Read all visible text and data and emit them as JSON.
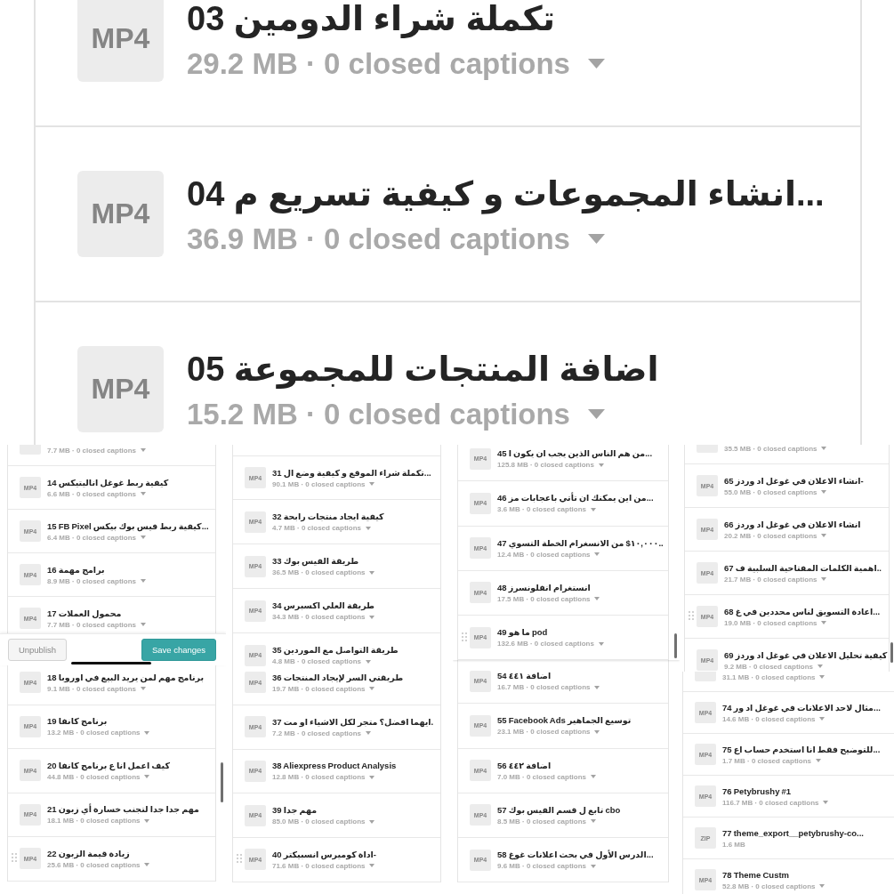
{
  "zoomed_list": {
    "files": [
      {
        "type": "MP4",
        "title": "03 تكملة شراء الدومين",
        "meta": "29.2 MB · 0 closed captions",
        "captions_menu": true,
        "hovered": false
      },
      {
        "type": "MP4",
        "title": "04 انشاء المجموعات و كيفية تسريع م...",
        "meta": "36.9 MB · 0 closed captions",
        "captions_menu": true,
        "hovered": false
      },
      {
        "type": "MP4",
        "title": "05 اضافة المنتجات للمجموعة",
        "meta": "15.2 MB · 0 closed captions",
        "captions_menu": true,
        "hovered": false
      }
    ]
  },
  "columns": [
    {
      "sections": [
        {
          "kind": "list",
          "scroll_indicator": false,
          "files": [
            {
              "meta": "7.7 MB · 0 closed captions",
              "captions_menu": true,
              "hovered": false
            },
            {
              "type": "MP4",
              "title": "14 كيفية ربط غوغل اناليتيكس",
              "meta": "6.6 MB · 0 closed captions",
              "captions_menu": true,
              "hovered": false
            },
            {
              "type": "MP4",
              "title": "15 FB Pixel كيفية ربط فيس بوك بيكس...",
              "meta": "6.4 MB · 0 closed captions",
              "captions_menu": true,
              "hovered": false
            },
            {
              "type": "MP4",
              "title": "16 برامج مهمة",
              "meta": "8.9 MB · 0 closed captions",
              "captions_menu": true,
              "hovered": false
            },
            {
              "type": "MP4",
              "title": "17 محمول العملات",
              "meta": "7.7 MB · 0 closed captions",
              "captions_menu": true,
              "hovered": false
            }
          ]
        },
        {
          "kind": "toolbar",
          "home_indicator": true,
          "buttons": [
            {
              "label": "Unpublish",
              "kind": "secondary"
            },
            {
              "label": "Save changes",
              "kind": "primary"
            }
          ]
        },
        {
          "kind": "list",
          "scroll_indicator": true,
          "files": [
            {
              "type": "MP4",
              "title": "18 برنامج مهم لمن يريد البيع في اوروبا",
              "meta": "9.1 MB · 0 closed captions",
              "captions_menu": true,
              "hovered": false
            },
            {
              "type": "MP4",
              "title": "19 برنامج كانفا",
              "meta": "13.2 MB · 0 closed captions",
              "captions_menu": true,
              "hovered": false
            },
            {
              "type": "MP4",
              "title": "20 كيف اعمل انا ع برنامج كانفا",
              "meta": "44.8 MB · 0 closed captions",
              "captions_menu": true,
              "hovered": false
            },
            {
              "type": "MP4",
              "title": "21 مهم جدا جدا لتجنب خسارة أي زبون",
              "meta": "18.1 MB · 0 closed captions",
              "captions_menu": true,
              "hovered": false
            },
            {
              "type": "MP4",
              "title": "22 زيادة قيمة الزبون",
              "meta": "25.6 MB · 0 closed captions",
              "captions_menu": true,
              "hovered": true
            }
          ]
        }
      ]
    },
    {
      "sections": [
        {
          "kind": "list",
          "scroll_indicator": false,
          "files": [
            {
              "type": "MP4",
              "title": "31 تكملة شراء الموقع و كيفية وضع ال...",
              "meta": "90.1 MB · 0 closed captions",
              "captions_menu": true,
              "hovered": false
            },
            {
              "type": "MP4",
              "title": "32 كيفية ايجاد منتجات رابحة",
              "meta": "4.7 MB · 0 closed captions",
              "captions_menu": true,
              "hovered": false
            },
            {
              "type": "MP4",
              "title": "33 طريقة الفيس بوك",
              "meta": "36.5 MB · 0 closed captions",
              "captions_menu": true,
              "hovered": false
            },
            {
              "type": "MP4",
              "title": "34 طريقة العلي اكسبرس",
              "meta": "34.3 MB · 0 closed captions",
              "captions_menu": true,
              "hovered": false
            },
            {
              "type": "MP4",
              "title": "35 طريقة التواصل مع الموردين",
              "meta": "4.8 MB · 0 closed captions",
              "captions_menu": true,
              "hovered": false
            }
          ]
        },
        {
          "kind": "list",
          "scroll_indicator": false,
          "files": [
            {
              "type": "MP4",
              "title": "36 طريقتي السر لإيجاد المنتجات",
              "meta": "19.7 MB · 0 closed captions",
              "captions_menu": true,
              "hovered": false
            },
            {
              "type": "MP4",
              "title": "37 ايهما افضل؟ متجر لكل الاشياء او مت.",
              "meta": "7.2 MB · 0 closed captions",
              "captions_menu": true,
              "hovered": false
            },
            {
              "type": "MP4",
              "title": "38 Aliexpress Product Analysis",
              "meta": "12.8 MB · 0 closed captions",
              "captions_menu": true,
              "hovered": false
            },
            {
              "type": "MP4",
              "title": "39 مهم جدا",
              "meta": "85.0 MB · 0 closed captions",
              "captions_menu": true,
              "hovered": false
            },
            {
              "type": "MP4",
              "title": "40 اداة كوميرس انسبيكتر-",
              "meta": "71.6 MB · 0 closed captions",
              "captions_menu": true,
              "hovered": true
            }
          ]
        }
      ]
    },
    {
      "sections": [
        {
          "kind": "list",
          "scroll_indicator": true,
          "files": [
            {
              "type": "MP4",
              "title": "45 من هم الناس الذين يجب ان يكون ا...",
              "meta": "125.8 MB · 0 closed captions",
              "captions_menu": true,
              "hovered": false
            },
            {
              "type": "MP4",
              "title": "46 من اين يمكنك ان تأتي باعجابات مز...",
              "meta": "3.6 MB · 0 closed captions",
              "captions_menu": true,
              "hovered": false
            },
            {
              "type": "MP4",
              "title": "47 ١٠,٠٠٠$ من الانسغرام الخطة التسوي..",
              "meta": "12.4 MB · 0 closed captions",
              "captions_menu": true,
              "hovered": false
            },
            {
              "type": "MP4",
              "title": "48 انستغرام انفلونسرز",
              "meta": "17.5 MB · 0 closed captions",
              "captions_menu": true,
              "hovered": false
            },
            {
              "type": "MP4",
              "title": "49 ما هو pod",
              "meta": "132.6 MB · 0 closed captions",
              "captions_menu": true,
              "hovered": true
            }
          ]
        },
        {
          "kind": "list",
          "scroll_indicator": false,
          "files": [
            {
              "type": "MP4",
              "title": "54 اضافة ٤٤١",
              "meta": "16.7 MB · 0 closed captions",
              "captions_menu": true,
              "hovered": false
            },
            {
              "type": "MP4",
              "title": "55 Facebook Ads توسيع الجماهير",
              "meta": "23.1 MB · 0 closed captions",
              "captions_menu": true,
              "hovered": false
            },
            {
              "type": "MP4",
              "title": "56 اضافة ٤٤٢",
              "meta": "7.0 MB · 0 closed captions",
              "captions_menu": true,
              "hovered": false
            },
            {
              "type": "MP4",
              "title": "57 تابع ل قسم الفيس بوك cbo",
              "meta": "8.5 MB · 0 closed captions",
              "captions_menu": true,
              "hovered": false
            },
            {
              "type": "MP4",
              "title": "58 الدرس الأول في بحث اعلانات غوغ...",
              "meta": "9.6 MB · 0 closed captions",
              "captions_menu": true,
              "hovered": false
            }
          ]
        }
      ]
    },
    {
      "sections": [
        {
          "kind": "list",
          "scroll_indicator": true,
          "files": [
            {
              "meta": "35.5 MB · 0 closed captions",
              "captions_menu": true,
              "hovered": false
            },
            {
              "type": "MP4",
              "title": "65 انشاء الاعلان في غوغل اد وردز-",
              "meta": "55.0 MB · 0 closed captions",
              "captions_menu": true,
              "hovered": false
            },
            {
              "type": "MP4",
              "title": "66 انشاء الاعلان في غوغل اد وردز",
              "meta": "20.2 MB · 0 closed captions",
              "captions_menu": true,
              "hovered": false
            },
            {
              "type": "MP4",
              "title": "67 اهمية الكلمات المفتاحية السلبية ف..",
              "meta": "21.7 MB · 0 closed captions",
              "captions_menu": true,
              "hovered": false
            },
            {
              "type": "MP4",
              "title": "68 اعادة التسويق لناس محددين في غ...",
              "meta": "19.0 MB · 0 closed captions",
              "captions_menu": true,
              "hovered": true
            },
            {
              "type": "MP4",
              "title": "69 كيفية تحليل الاعلان في غوغل اد وردز",
              "meta": "9.2 MB · 0 closed captions",
              "captions_menu": true,
              "hovered": false
            }
          ]
        },
        {
          "kind": "list",
          "scroll_indicator": false,
          "files": [
            {
              "meta": "31.1 MB · 0 closed captions",
              "captions_menu": true,
              "hovered": false
            },
            {
              "type": "MP4",
              "title": "74 مثال لاحد الاعلانات في غوغل اد ور...",
              "meta": "14.6 MB · 0 closed captions",
              "captions_menu": true,
              "hovered": false
            },
            {
              "type": "MP4",
              "title": "75 للتوضيح فقط انا استخدم حساب اع...",
              "meta": "1.7 MB · 0 closed captions",
              "captions_menu": true,
              "hovered": false
            },
            {
              "type": "MP4",
              "title": "76 Petybrushy #1",
              "meta": "116.7 MB · 0 closed captions",
              "captions_menu": true,
              "hovered": false
            },
            {
              "type": "ZIP",
              "title": "77 theme_export__petybrushy-co...",
              "meta": "1.6 MB",
              "captions_menu": false,
              "hovered": false
            },
            {
              "type": "MP4",
              "title": "78 Theme Custm",
              "meta": "52.8 MB · 0 closed captions",
              "captions_menu": true,
              "hovered": false
            }
          ]
        }
      ]
    }
  ]
}
